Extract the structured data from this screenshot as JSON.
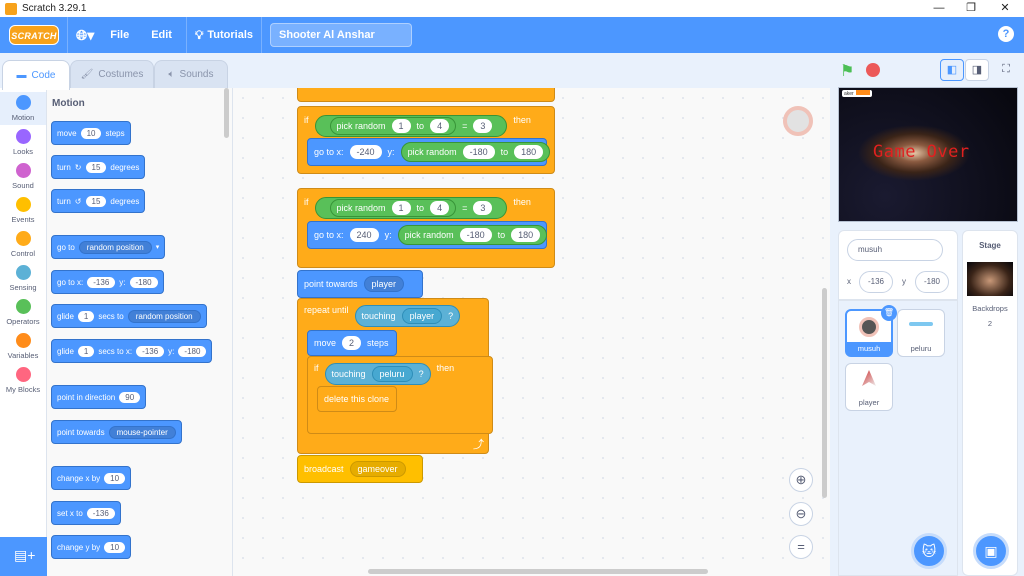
{
  "window": {
    "title": "Scratch 3.29.1"
  },
  "menu": {
    "logo": "SCRATCH",
    "file": "File",
    "edit": "Edit",
    "tutorials": "Tutorials",
    "project_title": "Shooter Al Anshar"
  },
  "tabs": {
    "code": "Code",
    "costumes": "Costumes",
    "sounds": "Sounds"
  },
  "categories": [
    {
      "label": "Motion",
      "color": "#4c97ff"
    },
    {
      "label": "Looks",
      "color": "#9966ff"
    },
    {
      "label": "Sound",
      "color": "#cf63cf"
    },
    {
      "label": "Events",
      "color": "#ffbf00"
    },
    {
      "label": "Control",
      "color": "#ffab19"
    },
    {
      "label": "Sensing",
      "color": "#5cb1d6"
    },
    {
      "label": "Operators",
      "color": "#59c059"
    },
    {
      "label": "Variables",
      "color": "#ff8c1a"
    },
    {
      "label": "My Blocks",
      "color": "#ff6680"
    }
  ],
  "palette": {
    "heading": "Motion",
    "move": {
      "a": "move",
      "v": "10",
      "b": "steps"
    },
    "turn_right": {
      "a": "turn",
      "v": "15",
      "b": "degrees"
    },
    "turn_left": {
      "a": "turn",
      "v": "15",
      "b": "degrees"
    },
    "goto": {
      "a": "go to",
      "dd": "random position"
    },
    "gotoxy": {
      "a": "go to x:",
      "x": "-136",
      "b": "y:",
      "y": "-180"
    },
    "glide": {
      "a": "glide",
      "v": "1",
      "b": "secs to",
      "dd": "random position"
    },
    "glidexy": {
      "a": "glide",
      "v": "1",
      "b": "secs to x:",
      "x": "-136",
      "c": "y:",
      "y": "-180"
    },
    "point_dir": {
      "a": "point in direction",
      "v": "90"
    },
    "point_towards": {
      "a": "point towards",
      "dd": "mouse-pointer"
    },
    "change_x": {
      "a": "change x by",
      "v": "10"
    },
    "set_x": {
      "a": "set x to",
      "v": "-136"
    },
    "change_y": {
      "a": "change y by",
      "v": "10"
    }
  },
  "script": {
    "if_kw": "if",
    "then_kw": "then",
    "pick_random": "pick random",
    "to_kw": "to",
    "eq": "=",
    "if1": {
      "r1": "1",
      "r2": "4",
      "cmp": "3",
      "goto": "go to x:",
      "x": "-240",
      "y_kw": "y:",
      "pr1": "-180",
      "pr2": "180"
    },
    "if2": {
      "r1": "1",
      "r2": "4",
      "cmp": "3",
      "goto": "go to x:",
      "x": "240",
      "y_kw": "y:",
      "pr1": "-180",
      "pr2": "180"
    },
    "point_towards": "point towards",
    "player": "player",
    "repeat_until": "repeat until",
    "touching": "touching",
    "q": "?",
    "move": "move",
    "move_v": "2",
    "steps": "steps",
    "peluru": "peluru",
    "delete_clone": "delete this clone",
    "broadcast": "broadcast",
    "gameover": "gameover"
  },
  "stage": {
    "game_over_text": "Game Over",
    "var_monitor": "aker"
  },
  "sprite_info": {
    "name": "musuh",
    "x_label": "x",
    "x": "-136",
    "y_label": "y",
    "y": "-180"
  },
  "sprites": [
    {
      "name": "musuh",
      "selected": true
    },
    {
      "name": "peluru",
      "selected": false
    },
    {
      "name": "player",
      "selected": false
    }
  ],
  "stage_panel": {
    "title": "Stage",
    "backdrops_label": "Backdrops",
    "backdrops_count": "2"
  }
}
